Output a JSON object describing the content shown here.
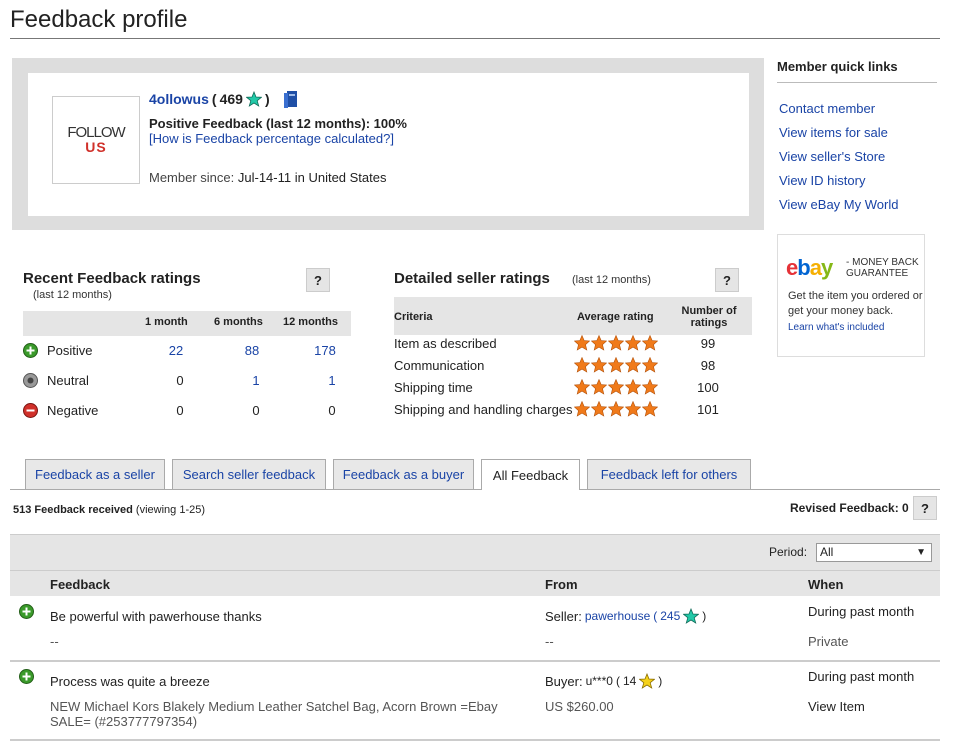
{
  "page": {
    "title": "Feedback profile"
  },
  "profile": {
    "logo_top": "FOLLOW",
    "logo_bottom": "US",
    "username": "4ollowus",
    "score_open": "(",
    "score": "469",
    "score_close": ")",
    "positive_feedback": "Positive Feedback (last 12 months): 100%",
    "how_link": "[How is Feedback percentage calculated?]",
    "member_since_label": "Member since:",
    "member_since_value": "Jul-14-11 in United States"
  },
  "quick_links": {
    "title": "Member quick links",
    "items": [
      "Contact member",
      "View items for sale",
      "View seller's Store",
      "View ID history",
      "View eBay My World"
    ]
  },
  "money_back": {
    "logo": [
      "e",
      "b",
      "a",
      "y"
    ],
    "tag_line1": "- MONEY BACK",
    "tag_line2": "GUARANTEE",
    "body": "Get the item you ordered or get your money back.",
    "link": "Learn what's included"
  },
  "recent": {
    "title": "Recent Feedback ratings",
    "subtitle": "(last 12 months)",
    "help": "?",
    "columns": [
      "1 month",
      "6 months",
      "12 months"
    ],
    "rows": [
      {
        "label": "Positive",
        "values": [
          "22",
          "88",
          "178"
        ]
      },
      {
        "label": "Neutral",
        "values": [
          "0",
          "1",
          "1"
        ]
      },
      {
        "label": "Negative",
        "values": [
          "0",
          "0",
          "0"
        ]
      }
    ]
  },
  "dsr": {
    "title": "Detailed seller ratings",
    "subtitle": "(last 12 months)",
    "help": "?",
    "col_criteria": "Criteria",
    "col_average": "Average rating",
    "col_count_line1": "Number of",
    "col_count_line2": "ratings",
    "rows": [
      {
        "criteria": "Item as described",
        "stars": 5,
        "count": "99"
      },
      {
        "criteria": "Communication",
        "stars": 5,
        "count": "98"
      },
      {
        "criteria": "Shipping time",
        "stars": 5,
        "count": "100"
      },
      {
        "criteria": "Shipping and handling charges",
        "stars": 5,
        "count": "101"
      }
    ]
  },
  "tabs": [
    {
      "label": "Feedback as a seller"
    },
    {
      "label": "Search seller feedback"
    },
    {
      "label": "Feedback as a buyer"
    },
    {
      "label": "All Feedback"
    },
    {
      "label": "Feedback left for others"
    }
  ],
  "summary": {
    "count": "513 Feedback received",
    "viewing": "(viewing 1-25)",
    "revised": "Revised Feedback: 0",
    "help": "?"
  },
  "period": {
    "label": "Period:",
    "value": "All"
  },
  "table": {
    "col_feedback": "Feedback",
    "col_from": "From",
    "col_when": "When",
    "rows": [
      {
        "comment": "Be powerful with pawerhouse thanks",
        "sub": "--",
        "from_role": "Seller:",
        "from_user": "pawerhouse",
        "from_open": "(",
        "from_score": "245",
        "from_close": ")",
        "from_sub": "--",
        "when": "During past month",
        "when_sub": "Private"
      },
      {
        "comment": "Process was quite a breeze",
        "sub": "NEW Michael Kors Blakely Medium Leather Satchel Bag, Acorn Brown =Ebay SALE= (#253777797354)",
        "from_role": "Buyer:",
        "from_user": "u***0",
        "from_open": "(",
        "from_score": "14",
        "from_close": ")",
        "from_sub": "US $260.00",
        "when": "During past month",
        "when_sub": "View Item"
      }
    ]
  },
  "colors": {
    "link": "#1a44a6",
    "positive": "#3a9a2a",
    "negative": "#d0302a",
    "panel": "#dddddd",
    "star_orange": "#f07a1a"
  }
}
